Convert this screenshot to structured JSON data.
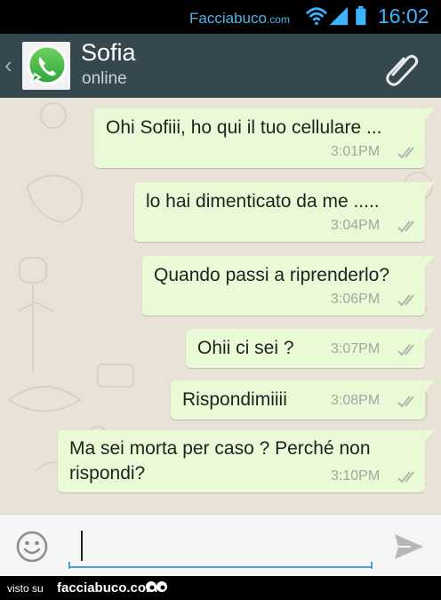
{
  "status_bar": {
    "watermark_main": "Facciabuco",
    "watermark_suffix": ".com",
    "time": "16:02",
    "icons": [
      "wifi-icon",
      "signal-icon",
      "battery-icon"
    ]
  },
  "header": {
    "contact_name": "Sofia",
    "contact_status": "online",
    "back_icon": "chevron-left-icon",
    "app_icon": "whatsapp-icon",
    "attach_icon": "paperclip-icon"
  },
  "messages": [
    {
      "text": "Ohi Sofiii, ho qui il tuo cellulare ...",
      "time": "3:01PM",
      "status": "read"
    },
    {
      "text": "lo hai dimenticato da me  .....",
      "time": "3:04PM",
      "status": "read"
    },
    {
      "text": "Quando passi a riprenderlo?",
      "time": "3:06PM",
      "status": "read"
    },
    {
      "text": "Ohii ci sei ?",
      "time": "3:07PM",
      "status": "read"
    },
    {
      "text": "Rispondimiiii",
      "time": "3:08PM",
      "status": "read"
    },
    {
      "text_line1": "Ma sei morta per caso ? Perché non",
      "text_line2": "rispondi?",
      "time": "3:10PM",
      "status": "read"
    }
  ],
  "composer": {
    "value": "",
    "emoji_icon": "smiley-icon",
    "send_icon": "send-icon"
  },
  "footer": {
    "visto": "visto su",
    "brand": "facciabuco.com"
  },
  "colors": {
    "header_bg": "#35484f",
    "chat_bg": "#e9e2d7",
    "bubble_out": "#eaf9d6",
    "accent": "#4aa3cf",
    "clock": "#3bb3ff"
  }
}
